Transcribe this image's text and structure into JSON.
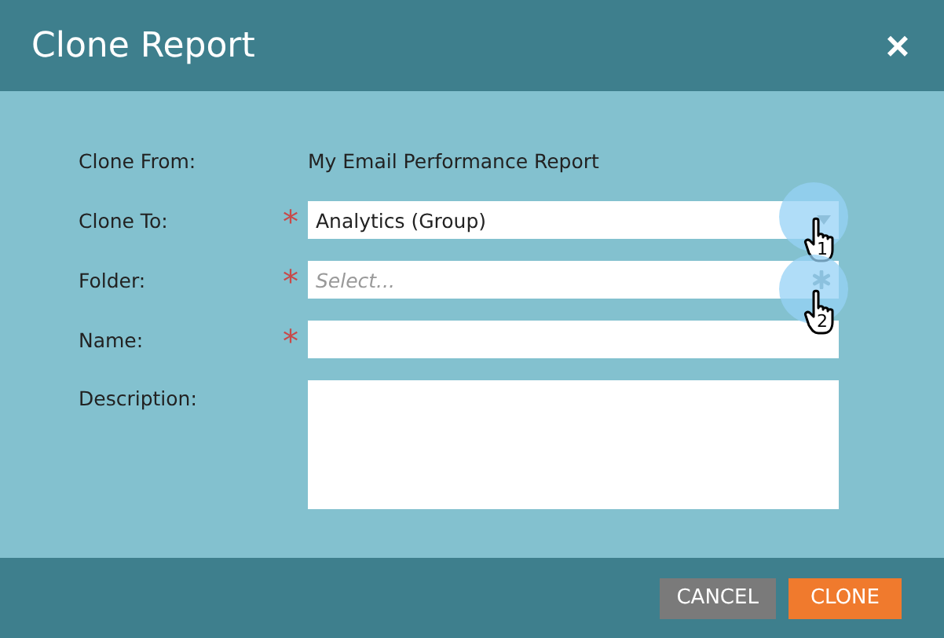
{
  "dialog": {
    "title": "Clone Report",
    "close": "×"
  },
  "fields": [
    {
      "kind": "static",
      "label": "Clone From:",
      "value": "My Email Performance Report"
    },
    {
      "kind": "select",
      "label": "Clone To:",
      "required_mark": "*",
      "value": "Analytics (Group)"
    },
    {
      "kind": "combo",
      "label": "Folder:",
      "required_mark": "*",
      "placeholder": "Select..."
    },
    {
      "kind": "text",
      "label": "Name:",
      "required_mark": "*"
    },
    {
      "kind": "textarea",
      "label": "Description:"
    }
  ],
  "markers": [
    {
      "label": "1"
    },
    {
      "label": "2"
    }
  ],
  "buttons": [
    {
      "label": "CANCEL",
      "kind": "secondary"
    },
    {
      "label": "CLONE",
      "kind": "primary"
    }
  ]
}
